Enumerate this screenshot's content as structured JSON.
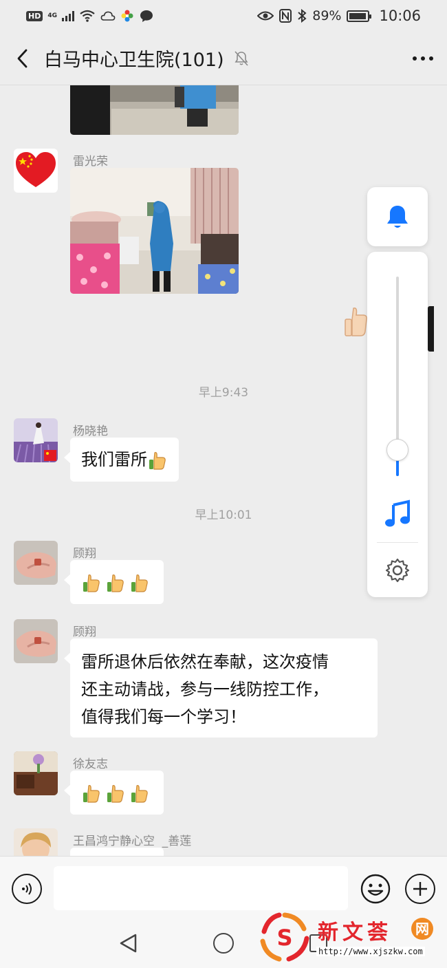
{
  "status_bar": {
    "hd": "HD",
    "network": "4G",
    "battery": "89%",
    "time": "10:06"
  },
  "header": {
    "title": "白马中心卫生院(101)"
  },
  "messages": [
    {
      "sender": "雷光荣",
      "type": "image",
      "image_desc": "medical worker in blue protective gown in a bedroom"
    },
    {
      "timestamp": "早上9:43"
    },
    {
      "sender": "杨晓艳",
      "text": "我们雷所",
      "emoji": "thumbs-up"
    },
    {
      "timestamp": "早上10:01"
    },
    {
      "sender": "顾翔",
      "emoji_count": 3,
      "emoji": "thumbs-up"
    },
    {
      "sender": "顾翔",
      "lines": [
        "雷所退休后依然在奉献，这次疫情",
        "还主动请战，参与一线防控工作，",
        "值得我们每一个学习！"
      ]
    },
    {
      "sender": "徐友志",
      "emoji_count": 3,
      "emoji": "thumbs-up"
    },
    {
      "sender": "王昌鸿宁静心空  _善莲"
    }
  ],
  "volume_panel": {
    "level": 0.1,
    "icons": [
      "bell-icon",
      "music-note-icon",
      "gear-icon"
    ],
    "accent": "#1677ff"
  },
  "input_bar": {
    "value": "",
    "placeholder": ""
  },
  "watermark": {
    "title": "新文荟",
    "badge": "网",
    "url": "http://www.xjszkw.com"
  },
  "colors": {
    "background": "#ededed",
    "bubble": "#ffffff",
    "meta_text": "#8a8a8a"
  }
}
